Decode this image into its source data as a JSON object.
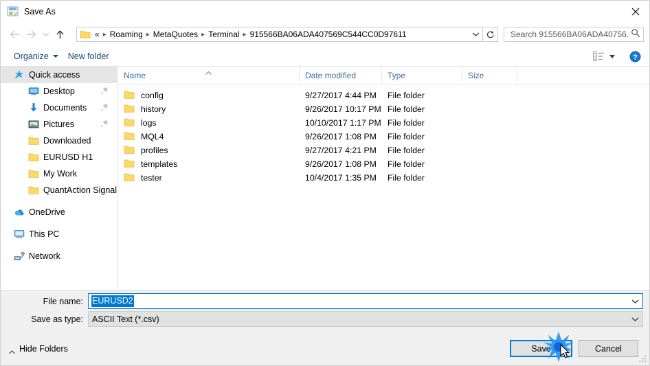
{
  "window": {
    "title": "Save As",
    "title_icon": "save-as-icon",
    "close_icon": "close-icon"
  },
  "nav": {
    "back_icon": "arrow-left-icon",
    "forward_icon": "arrow-right-icon",
    "recent_icon": "chevron-down-icon",
    "up_icon": "arrow-up-icon",
    "refresh_icon": "refresh-icon",
    "address_folder_icon": "folder-icon",
    "breadcrumbs": [
      "«",
      "Roaming",
      "MetaQuotes",
      "Terminal",
      "915566BA06ADA407569C544CC0D97611"
    ],
    "address_dropdown_icon": "chevron-down-icon"
  },
  "search": {
    "placeholder": "Search 915566BA06ADA40756...",
    "value": "",
    "icon": "search-icon"
  },
  "toolbar": {
    "organize_label": "Organize",
    "new_folder_label": "New folder",
    "view_icon": "view-details-icon",
    "help_icon": "help-icon"
  },
  "sidebar": {
    "items": [
      {
        "label": "Quick access",
        "icon": "star-icon",
        "level": "root",
        "selected": true,
        "pinned": false
      },
      {
        "label": "Desktop",
        "icon": "desktop-icon",
        "level": "child",
        "selected": false,
        "pinned": true
      },
      {
        "label": "Documents",
        "icon": "documents-icon",
        "level": "child",
        "selected": false,
        "pinned": true
      },
      {
        "label": "Pictures",
        "icon": "pictures-icon",
        "level": "child",
        "selected": false,
        "pinned": true
      },
      {
        "label": "Downloaded",
        "icon": "folder-icon",
        "level": "child",
        "selected": false,
        "pinned": false
      },
      {
        "label": "EURUSD H1",
        "icon": "folder-icon",
        "level": "child",
        "selected": false,
        "pinned": false
      },
      {
        "label": "My Work",
        "icon": "folder-icon",
        "level": "child",
        "selected": false,
        "pinned": false
      },
      {
        "label": "QuantAction Signal",
        "icon": "folder-icon",
        "level": "child",
        "selected": false,
        "pinned": false
      },
      {
        "label": "OneDrive",
        "icon": "onedrive-icon",
        "level": "root",
        "selected": false,
        "pinned": false,
        "gap_before": true
      },
      {
        "label": "This PC",
        "icon": "thispc-icon",
        "level": "root",
        "selected": false,
        "pinned": false,
        "gap_before": true
      },
      {
        "label": "Network",
        "icon": "network-icon",
        "level": "root",
        "selected": false,
        "pinned": false,
        "gap_before": true
      }
    ]
  },
  "filelist": {
    "columns": [
      "Name",
      "Date modified",
      "Type",
      "Size"
    ],
    "sort_column": "Name",
    "sort_direction": "ascending",
    "rows": [
      {
        "name": "config",
        "date": "9/27/2017 4:44 PM",
        "type": "File folder",
        "size": "",
        "icon": "folder-icon"
      },
      {
        "name": "history",
        "date": "9/26/2017 10:17 PM",
        "type": "File folder",
        "size": "",
        "icon": "folder-icon"
      },
      {
        "name": "logs",
        "date": "10/10/2017 1:17 PM",
        "type": "File folder",
        "size": "",
        "icon": "folder-icon"
      },
      {
        "name": "MQL4",
        "date": "9/26/2017 1:08 PM",
        "type": "File folder",
        "size": "",
        "icon": "folder-icon"
      },
      {
        "name": "profiles",
        "date": "9/27/2017 4:21 PM",
        "type": "File folder",
        "size": "",
        "icon": "folder-icon"
      },
      {
        "name": "templates",
        "date": "9/26/2017 1:08 PM",
        "type": "File folder",
        "size": "",
        "icon": "folder-icon"
      },
      {
        "name": "tester",
        "date": "10/4/2017 1:35 PM",
        "type": "File folder",
        "size": "",
        "icon": "folder-icon"
      }
    ]
  },
  "form": {
    "filename_label": "File name:",
    "filename_value": "EURUSD2",
    "filename_selected": true,
    "filetype_label": "Save as type:",
    "filetype_value": "ASCII Text (*.csv)"
  },
  "footer": {
    "hide_folders_label": "Hide Folders",
    "save_label": "Save",
    "cancel_label": "Cancel"
  },
  "colors": {
    "accent": "#0078d7",
    "link": "#16437e",
    "folder": "#ffd866",
    "chrome": "#f0f0f0"
  }
}
